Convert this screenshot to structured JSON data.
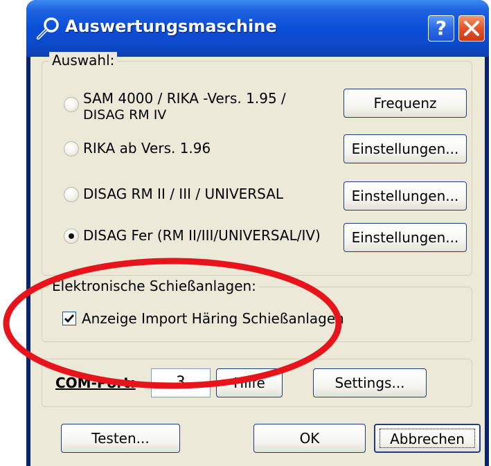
{
  "window": {
    "title": "Auswertungsmaschine",
    "help_label": "?"
  },
  "auswahl": {
    "group_label": "Auswahl:",
    "options": [
      {
        "line1": "SAM 4000 / RIKA -Vers. 1.95 /",
        "line2": "DISAG RM IV",
        "button": "Frequenz",
        "selected": false
      },
      {
        "line1": "RIKA ab Vers. 1.96",
        "button": "Einstellungen...",
        "selected": false
      },
      {
        "line1": "DISAG RM II / III / UNIVERSAL",
        "button": "Einstellungen...",
        "selected": false
      },
      {
        "line1": "DISAG Fer (RM II/III/UNIVERSAL/IV)",
        "button": "Einstellungen...",
        "selected": true
      }
    ]
  },
  "elektronisch": {
    "group_label": "Elektronische Schießanlagen:",
    "checkbox_label": "Anzeige Import Häring Schießanlagen",
    "checked": true
  },
  "com": {
    "label": "COM-Port:",
    "value": "3",
    "help_button": "Hilfe",
    "settings_button": "Settings..."
  },
  "footer": {
    "test_button": "Testen...",
    "ok_button": "OK",
    "cancel_button": "Abbrechen"
  },
  "annotation": {
    "color": "#e8141c"
  }
}
